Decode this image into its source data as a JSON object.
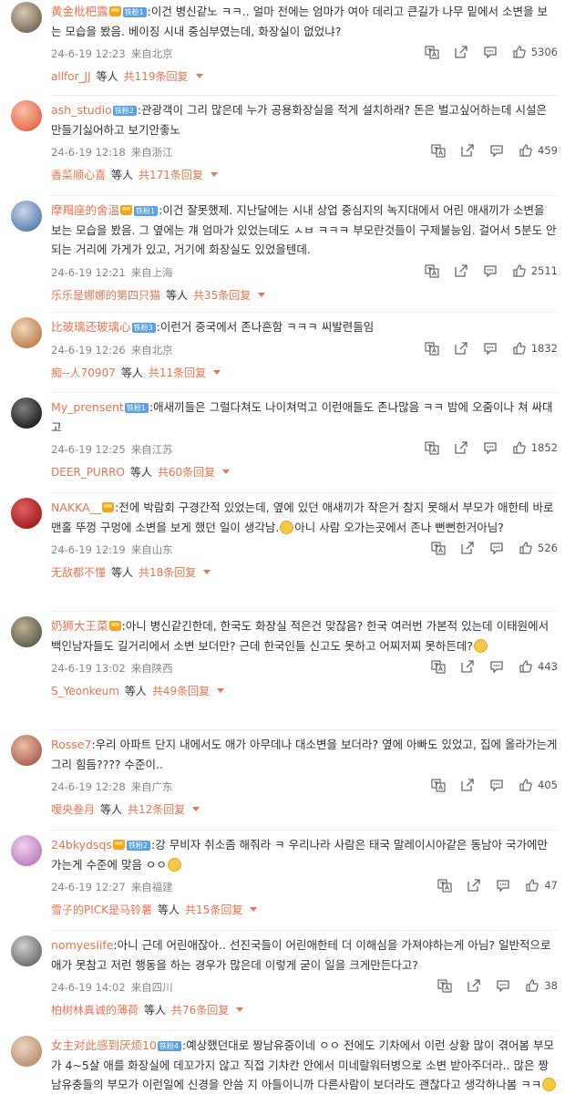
{
  "comments": [
    {
      "user": "黄金枇杷露",
      "has_crown": true,
      "fan_badge": "铁粉1",
      "text": ":이건 병신같노 ㅋㅋ.. 얼마 전에는 엄마가 여아 데리고 큰길가 나무 밑에서 소변을 보는 모습을 봤음. 베이징 시내 중심부였는데, 화장실이 없었냐?",
      "date": "24-6-19 12:23",
      "location": "来自北京",
      "likes": "5306",
      "reply_user": "allfor_JJ",
      "reply_mid": "等人",
      "reply_total": "共119条回复"
    },
    {
      "user": "ash_studio",
      "has_crown": false,
      "fan_badge": "铁粉2",
      "text": ":관광객이 그리 많은데 누가 공용화장실을 적게 설치하래? 돈은 벌고싶어하는데 시설은 만들기싫어하고 보기안좋노",
      "date": "24-6-19 12:18",
      "location": "来自浙江",
      "likes": "459",
      "reply_user": "香菜顺心喜",
      "reply_mid": "等人",
      "reply_total": "共171条回复"
    },
    {
      "user": "摩羯座的舍温",
      "has_crown": true,
      "fan_badge": "铁粉1",
      "text": ":이건 잘못했제. 지난달에는 시내 상업 중심지의 녹지대에서 어린 애새끼가 소변을 보는 모습을 봤음. 그 옆에는 걔 엄마가 있었는데도 ㅅㅂ ㅋㅋㅋ 부모란것들이 구제불능임. 걸어서 5분도 안 되는 거리에 가게가 있고, 거기에 화장실도 있었을텐데.",
      "date": "24-6-19 12:21",
      "location": "来自上海",
      "likes": "2511",
      "reply_user": "乐乐是娜娜的第四只猫",
      "reply_mid": "等人",
      "reply_total": "共35条回复"
    },
    {
      "user": "比玻璃还玻璃心",
      "has_crown": false,
      "fan_badge": "铁粉3",
      "text": ":이런거 중국에서 존나흔함 ㅋㅋㅋ 씨발련들임",
      "date": "24-6-19 12:26",
      "location": "来自北京",
      "likes": "1832",
      "reply_user": "痴--人70907",
      "reply_mid": "等人",
      "reply_total": "共11条回复"
    },
    {
      "user": "My_prensent",
      "has_crown": false,
      "fan_badge": "铁粉1",
      "text": ":애새끼들은 그럴다쳐도 나이쳐먹고 이런애들도 존나많음 ㅋㅋ 밤에 오줌이나 쳐 싸대고",
      "date": "24-6-19 12:25",
      "location": "来自江苏",
      "likes": "1852",
      "reply_user": "DEER_PURRO",
      "reply_mid": "等人",
      "reply_total": "共60条回复"
    },
    {
      "user": "NAKKA__",
      "has_crown": true,
      "fan_badge": "",
      "text": ":전에 박람회 구경간적 있었는데, 옆에 있던 애새끼가 작은거 참지 못해서 부모가 애한테 바로 맨홀 뚜껑 구멍에 소변을 보게 했던 일이 생각남.",
      "text_after_emoji": "아니 사람 오가는곳에서 존나 뻔뻔한거아님?",
      "emoji_mid": true,
      "date": "24-6-19 12:19",
      "location": "来自山东",
      "likes": "526",
      "reply_user": "无敌都不懂",
      "reply_mid": "等人",
      "reply_total": "共18条回复"
    },
    {
      "user": "奶狮大王菜",
      "has_crown": true,
      "fan_badge": "",
      "text": ":아니 병신같긴한데, 한국도 화장실 적은건 맞잖음? 한국 여러번 가본적 있는데 이태원에서 백인남자들도 길거리에서 소변 보더만? 근데 한국인들 신고도 못하고 어찌저찌 못하든데?",
      "emoji_end": true,
      "date": "24-6-19 13:02",
      "location": "来自陕西",
      "likes": "443",
      "reply_user": "S_Yeonkeum",
      "reply_mid": "等人",
      "reply_total": "共49条回复"
    },
    {
      "user": "Rosse7",
      "has_crown": false,
      "fan_badge": "",
      "text": ":우리 아파트 단지 내에서도 애가 아무데나 대소변을 보더라? 옆에 아빠도 있었고, 집에 올라가는게 그리 힘듬???? 수준이..",
      "date": "24-6-19 12:28",
      "location": "来自广东",
      "likes": "405",
      "reply_user": "嗳央叁月",
      "reply_mid": "等人",
      "reply_total": "共12条回复"
    },
    {
      "user": "24bkydsqs",
      "has_crown": true,
      "fan_badge": "铁粉2",
      "text": ":강 무비자 취소좀 해줘라 ㅋ 우리나라 사람은 태국 말레이시아같은 동남아 국가에만 가는게 수준에 맞음 ㅇㅇ",
      "emoji_end": true,
      "date": "24-6-19 12:27",
      "location": "来自福建",
      "likes": "47",
      "reply_user": "雪子的PICK是马铃薯",
      "reply_mid": "等人",
      "reply_total": "共15条回复"
    },
    {
      "user": "nomyeslife",
      "has_crown": false,
      "fan_badge": "",
      "text": ":아니 근데 어린애잖아.. 선진국들이 어린애한테 더 이해심을 가져야하는게 아님? 일반적으로 애가 못참고 저런 행동을 하는 경우가 많은데 이렇게 굳이 일을 크게만든다고?",
      "date": "24-6-19 14:02",
      "location": "来自四川",
      "likes": "38",
      "reply_user": "柏树林真诚的薄荷",
      "reply_mid": "等人",
      "reply_total": "共76条回复"
    },
    {
      "user": "女主对此感到厌烦10",
      "has_crown": false,
      "fan_badge": "铁粉4",
      "text": ":예상했던대로 짱남유중이네 ㅇㅇ 전에도 기차에서 이런 상황 많이 겪어봄 부모가 4~5살 애를 화장실에 데꼬가지 않고 직접 기차칸 안에서 미네랄워터병으로 소변 받아주더라.. 많은 짱남유충들의 부모가 이런일에 신경을 안씀 지 아들이니까 다른사람이 보더라도 괜찮다고 생각하나봄 ㅋㅋ",
      "emoji_end": true,
      "date": "",
      "location": "",
      "likes": "",
      "reply_user": "",
      "reply_mid": "",
      "reply_total": ""
    }
  ],
  "icons": {
    "translate": "translate-icon",
    "share": "share-icon",
    "comment": "comment-icon",
    "like": "thumbs-up-icon"
  },
  "colors": {
    "accent": "#eb7350",
    "meta": "#888888",
    "fan_badge": "#5aa0e6"
  }
}
